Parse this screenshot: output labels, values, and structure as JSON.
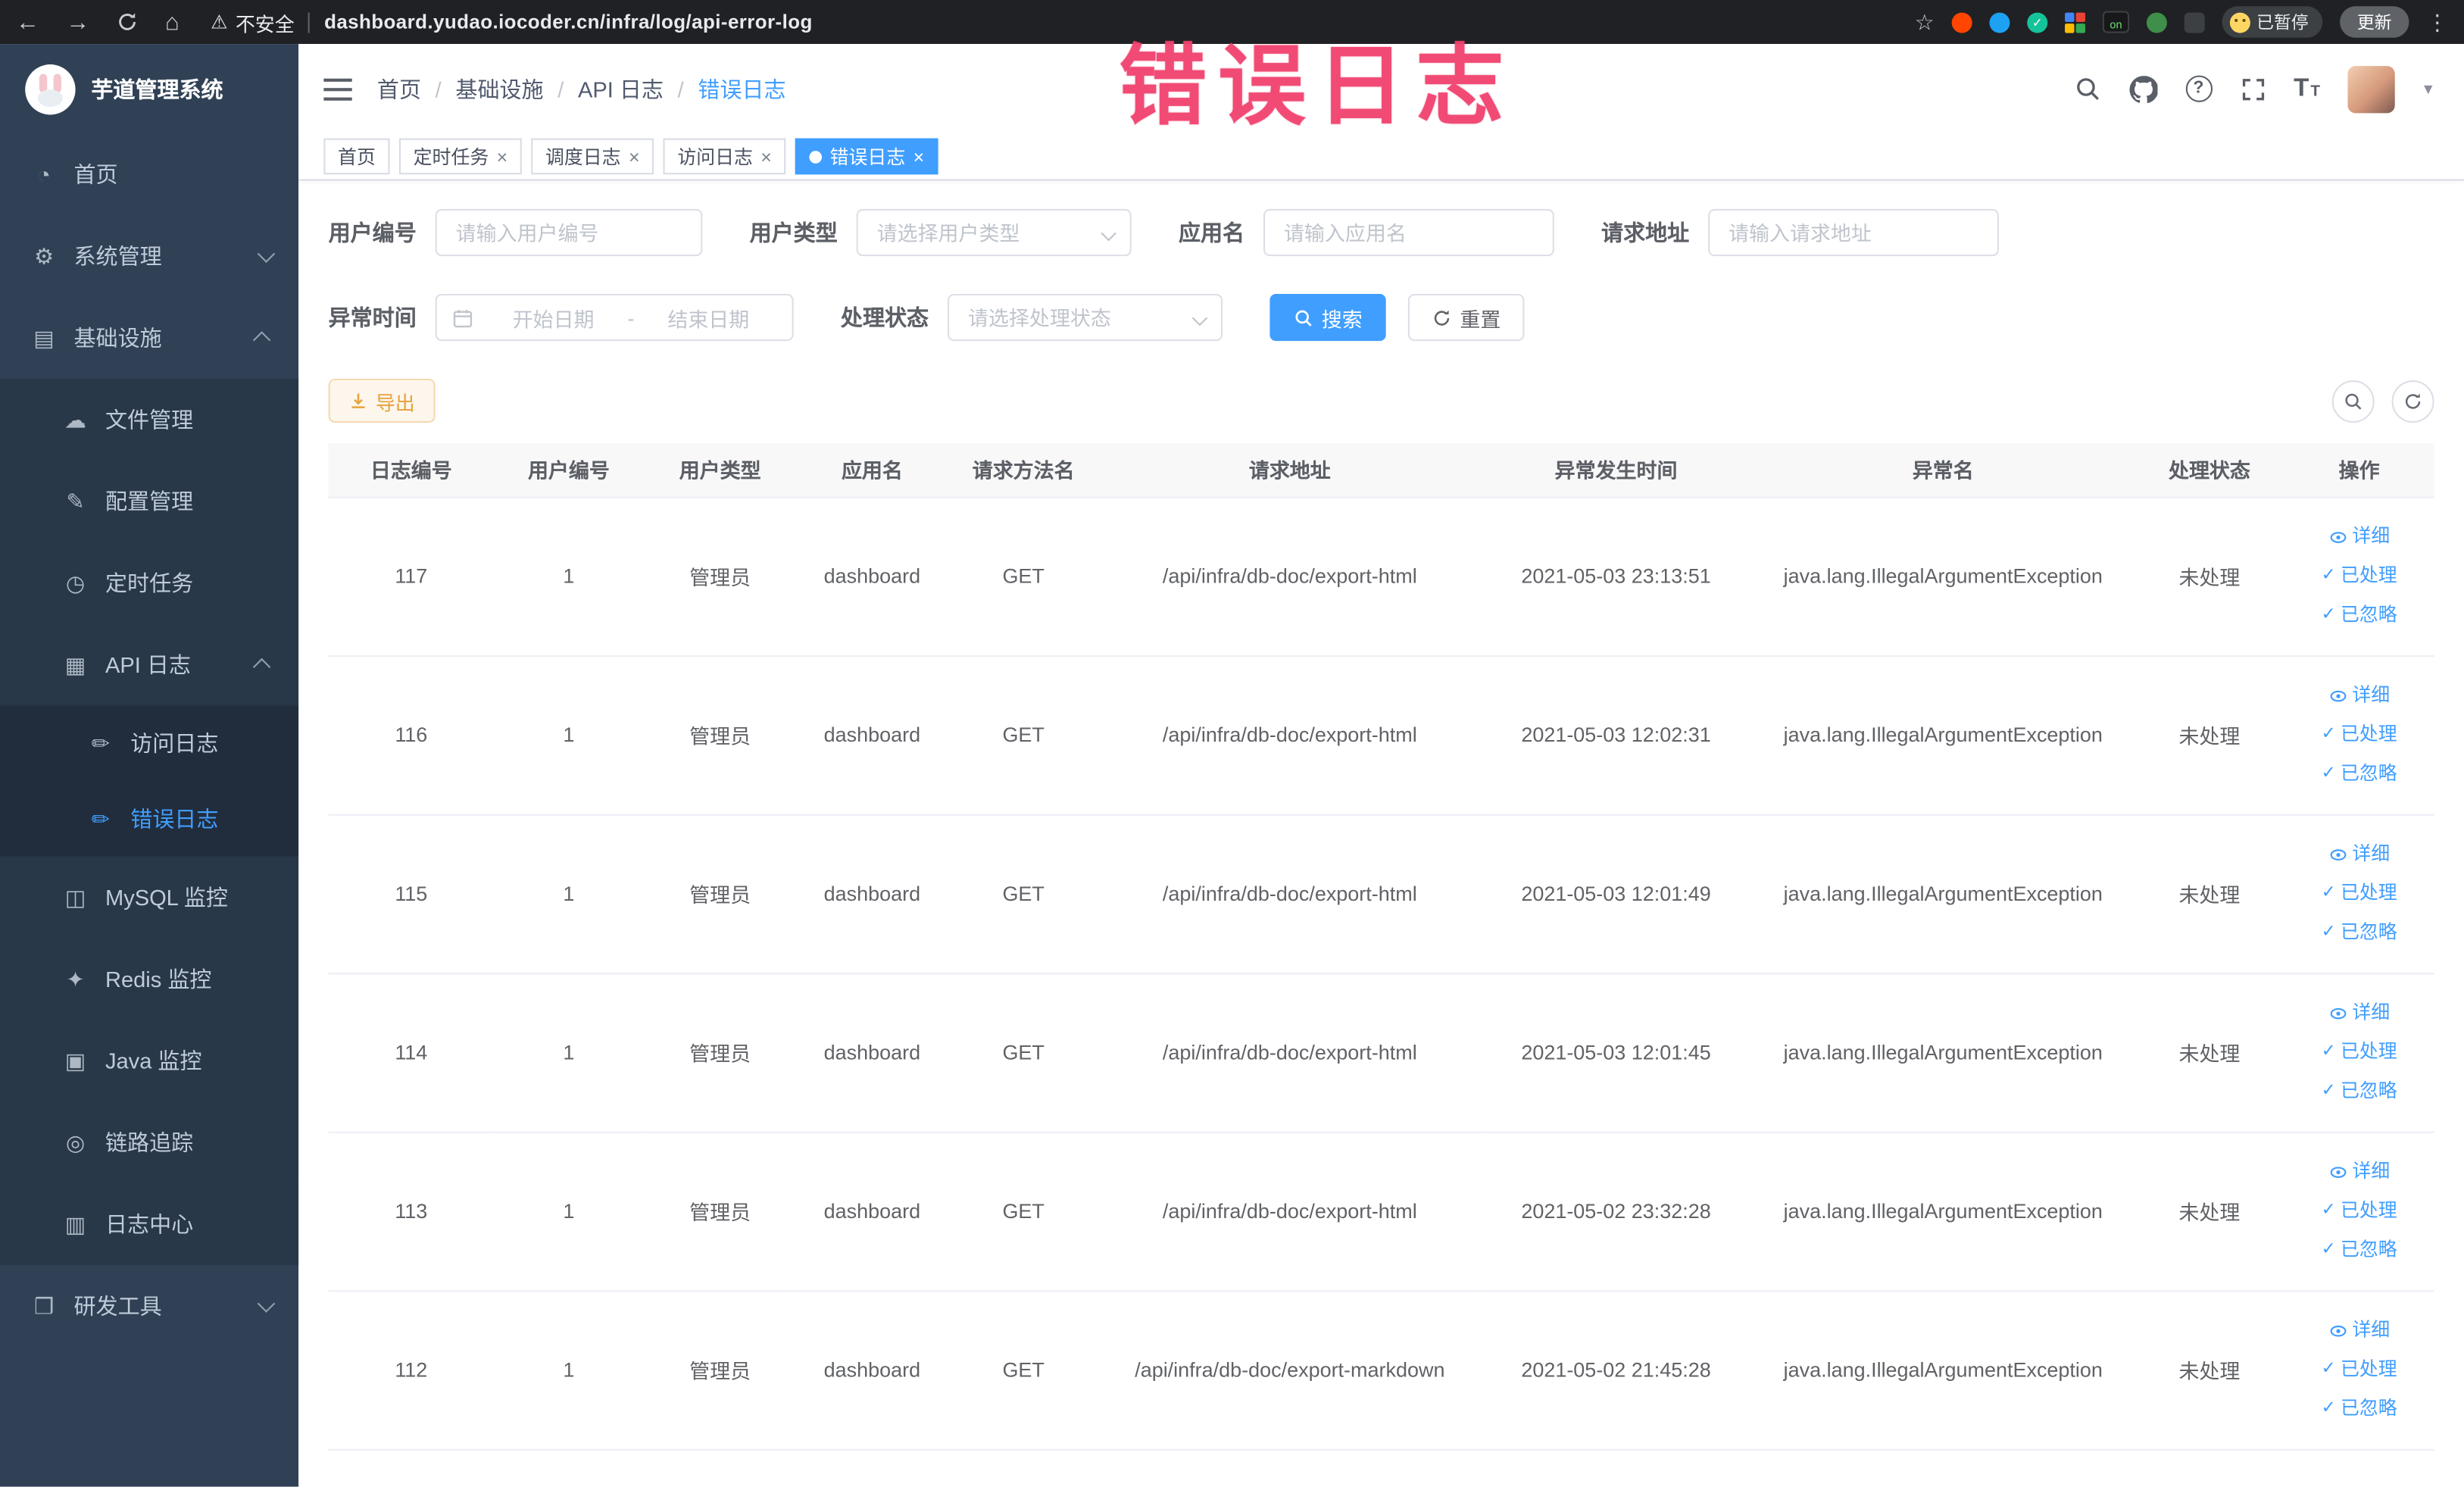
{
  "browser": {
    "security_label": "不安全",
    "url": "dashboard.yudao.iocoder.cn/infra/log/api-error-log",
    "paused_label": "已暂停",
    "update_label": "更新"
  },
  "annotation": {
    "text": "错误日志",
    "color": "#f1426e"
  },
  "icons": {
    "back_arrow": "←",
    "forward_arrow": "→",
    "home": "⌂",
    "warning": "⚠",
    "star": "☆",
    "kebab": "⋮",
    "close": "×",
    "check": "✓",
    "caret_down": "▾",
    "question": "?",
    "font_size_large": "T",
    "font_size_small": "T",
    "on_badge": "on"
  },
  "sidebar": {
    "logo_title": "芋道管理系统",
    "items": [
      {
        "icon": "dashboard-icon",
        "glyph": "◔",
        "label": "首页"
      },
      {
        "icon": "gear-icon",
        "glyph": "⚙",
        "label": "系统管理"
      },
      {
        "icon": "infrastructure-icon",
        "glyph": "▤",
        "label": "基础设施"
      },
      {
        "icon": "file-management-icon",
        "glyph": "☁",
        "label": "文件管理"
      },
      {
        "icon": "config-icon",
        "glyph": "✎",
        "label": "配置管理"
      },
      {
        "icon": "cron-job-icon",
        "glyph": "◷",
        "label": "定时任务"
      },
      {
        "icon": "api-log-icon",
        "glyph": "▦",
        "label": "API 日志"
      },
      {
        "icon": "access-log-icon",
        "glyph": "✏",
        "label": "访问日志"
      },
      {
        "icon": "error-log-icon",
        "glyph": "✏",
        "label": "错误日志"
      },
      {
        "icon": "mysql-monitor-icon",
        "glyph": "◫",
        "label": "MySQL 监控"
      },
      {
        "icon": "redis-monitor-icon",
        "glyph": "✦",
        "label": "Redis 监控"
      },
      {
        "icon": "java-monitor-icon",
        "glyph": "▣",
        "label": "Java 监控"
      },
      {
        "icon": "trace-icon",
        "glyph": "◎",
        "label": "链路追踪"
      },
      {
        "icon": "log-center-icon",
        "glyph": "▥",
        "label": "日志中心"
      },
      {
        "icon": "dev-tools-icon",
        "glyph": "❒",
        "label": "研发工具"
      }
    ]
  },
  "header": {
    "breadcrumb": [
      "首页",
      "基础设施",
      "API 日志",
      "错误日志"
    ],
    "separator": "/"
  },
  "tabs": [
    {
      "label": "首页",
      "closable": false,
      "active": false
    },
    {
      "label": "定时任务",
      "closable": true,
      "active": false
    },
    {
      "label": "调度日志",
      "closable": true,
      "active": false
    },
    {
      "label": "访问日志",
      "closable": true,
      "active": false
    },
    {
      "label": "错误日志",
      "closable": true,
      "active": true
    }
  ],
  "filters": {
    "user_id": {
      "label": "用户编号",
      "placeholder": "请输入用户编号"
    },
    "user_type": {
      "label": "用户类型",
      "placeholder": "请选择用户类型"
    },
    "app_name": {
      "label": "应用名",
      "placeholder": "请输入应用名"
    },
    "request_url": {
      "label": "请求地址",
      "placeholder": "请输入请求地址"
    },
    "exception_time": {
      "label": "异常时间",
      "start_placeholder": "开始日期",
      "separator": "-",
      "end_placeholder": "结束日期"
    },
    "process_status": {
      "label": "处理状态",
      "placeholder": "请选择处理状态"
    },
    "search_label": "搜索",
    "reset_label": "重置"
  },
  "toolbar": {
    "export_label": "导出"
  },
  "table": {
    "columns": [
      "日志编号",
      "用户编号",
      "用户类型",
      "应用名",
      "请求方法名",
      "请求地址",
      "异常发生时间",
      "异常名",
      "处理状态",
      "操作"
    ],
    "actions": {
      "detail": "详细",
      "processed": "已处理",
      "ignored": "已忽略"
    },
    "rows": [
      {
        "log_id": "117",
        "user_id": "1",
        "user_type": "管理员",
        "app_name": "dashboard",
        "method": "GET",
        "url": "/api/infra/db-doc/export-html",
        "time": "2021-05-03 23:13:51",
        "exception": "java.lang.IllegalArgumentException",
        "status": "未处理"
      },
      {
        "log_id": "116",
        "user_id": "1",
        "user_type": "管理员",
        "app_name": "dashboard",
        "method": "GET",
        "url": "/api/infra/db-doc/export-html",
        "time": "2021-05-03 12:02:31",
        "exception": "java.lang.IllegalArgumentException",
        "status": "未处理"
      },
      {
        "log_id": "115",
        "user_id": "1",
        "user_type": "管理员",
        "app_name": "dashboard",
        "method": "GET",
        "url": "/api/infra/db-doc/export-html",
        "time": "2021-05-03 12:01:49",
        "exception": "java.lang.IllegalArgumentException",
        "status": "未处理"
      },
      {
        "log_id": "114",
        "user_id": "1",
        "user_type": "管理员",
        "app_name": "dashboard",
        "method": "GET",
        "url": "/api/infra/db-doc/export-html",
        "time": "2021-05-03 12:01:45",
        "exception": "java.lang.IllegalArgumentException",
        "status": "未处理"
      },
      {
        "log_id": "113",
        "user_id": "1",
        "user_type": "管理员",
        "app_name": "dashboard",
        "method": "GET",
        "url": "/api/infra/db-doc/export-html",
        "time": "2021-05-02 23:32:28",
        "exception": "java.lang.IllegalArgumentException",
        "status": "未处理"
      },
      {
        "log_id": "112",
        "user_id": "1",
        "user_type": "管理员",
        "app_name": "dashboard",
        "method": "GET",
        "url": "/api/infra/db-doc/export-markdown",
        "time": "2021-05-02 21:45:28",
        "exception": "java.lang.IllegalArgumentException",
        "status": "未处理"
      }
    ]
  }
}
